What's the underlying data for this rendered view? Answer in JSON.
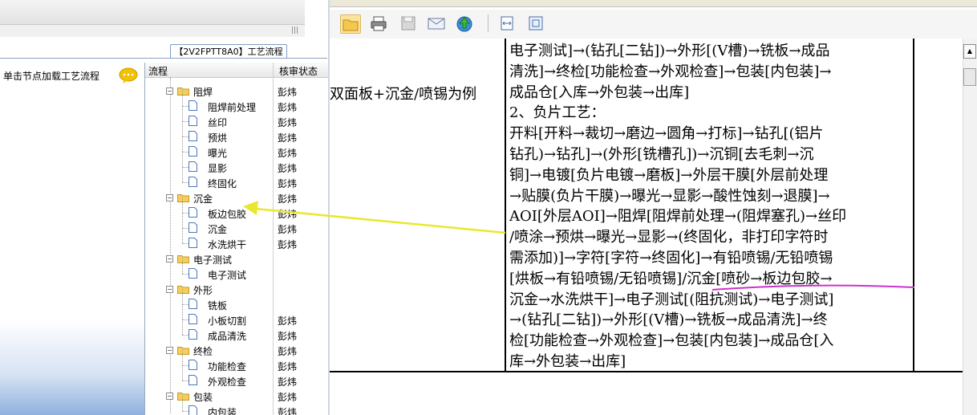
{
  "left_panel": {
    "hint_text": "单击节点加载工艺流程",
    "flow_tab_title": "【2V2FPTT8A0】工艺流程",
    "columns": {
      "flow": "流程",
      "status": "核审状态"
    },
    "tree": [
      {
        "label": "阻焊",
        "type": "folder",
        "status": "彭炜"
      },
      {
        "label": "阻焊前处理",
        "type": "doc",
        "status": "彭炜"
      },
      {
        "label": "丝印",
        "type": "doc",
        "status": "彭炜"
      },
      {
        "label": "预烘",
        "type": "doc",
        "status": "彭炜"
      },
      {
        "label": "曝光",
        "type": "doc",
        "status": "彭炜"
      },
      {
        "label": "显影",
        "type": "doc",
        "status": "彭炜"
      },
      {
        "label": "终固化",
        "type": "doc",
        "status": "彭炜"
      },
      {
        "label": "沉金",
        "type": "folder",
        "status": "彭炜"
      },
      {
        "label": "板边包胶",
        "type": "doc",
        "status": "彭炜"
      },
      {
        "label": "沉金",
        "type": "doc",
        "status": "彭炜"
      },
      {
        "label": "水洗烘干",
        "type": "doc",
        "status": "彭炜"
      },
      {
        "label": "电子测试",
        "type": "folder",
        "status": ""
      },
      {
        "label": "电子测试",
        "type": "doc",
        "status": ""
      },
      {
        "label": "外形",
        "type": "folder",
        "status": ""
      },
      {
        "label": "铣板",
        "type": "doc",
        "status": ""
      },
      {
        "label": "小板切割",
        "type": "doc",
        "status": "彭炜"
      },
      {
        "label": "成品清洗",
        "type": "doc",
        "status": "彭炜"
      },
      {
        "label": "终检",
        "type": "folder",
        "status": "彭炜"
      },
      {
        "label": "功能检查",
        "type": "doc",
        "status": "彭炜"
      },
      {
        "label": "外观检查",
        "type": "doc",
        "status": "彭炜"
      },
      {
        "label": "包装",
        "type": "folder",
        "status": "彭炜"
      },
      {
        "label": "内包装",
        "type": "doc",
        "status": "彭炜"
      }
    ]
  },
  "toolbar": {
    "buttons": [
      "open-folder-icon",
      "print-icon",
      "save-icon",
      "email-icon",
      "publish-icon",
      "fit-page-icon",
      "fit-window-icon"
    ]
  },
  "document": {
    "title_cell": "双面板+沉金/喷锡为例",
    "content_lines": [
      "电子测试]→(钻孔[二钻])→外形[(V槽)→铣板→成品",
      "清洗]→终检[功能检查→外观检查]→包装[内包装]→",
      "成品仓[入库→外包装→出库]",
      "2、负片工艺：",
      "开料[开料→裁切→磨边→圆角→打标]→钻孔[(铝片",
      "钻孔)→钻孔]→(外形[铣槽孔])→沉铜[去毛刺→沉",
      "铜]→电镀[负片电镀→磨板]→外层干膜[外层前处理",
      "→贴膜(负片干膜)→曝光→显影→酸性蚀刻→退膜]→",
      "AOI[外层AOI]→阻焊[阻焊前处理→(阻焊塞孔)→丝印",
      "/喷涂→预烘→曝光→显影→(终固化，非打印字符时",
      "需添加)]→字符[字符→终固化]→有铅喷锡/无铅喷锡",
      "[烘板→有铅喷锡/无铅喷锡]/沉金[喷砂→板边包胶→",
      "沉金→水洗烘干]→电子测试[(阻抗测试)→电子测试]",
      "→(钻孔[二钻])→外形[(V槽)→铣板→成品清洗]→终",
      "检[功能检查→外观检查]→包装[内包装]→成品仓[入",
      "库→外包装→出库]"
    ]
  },
  "colors": {
    "annotation_arrow": "#e8e830",
    "annotation_underline": "#cc33cc"
  }
}
